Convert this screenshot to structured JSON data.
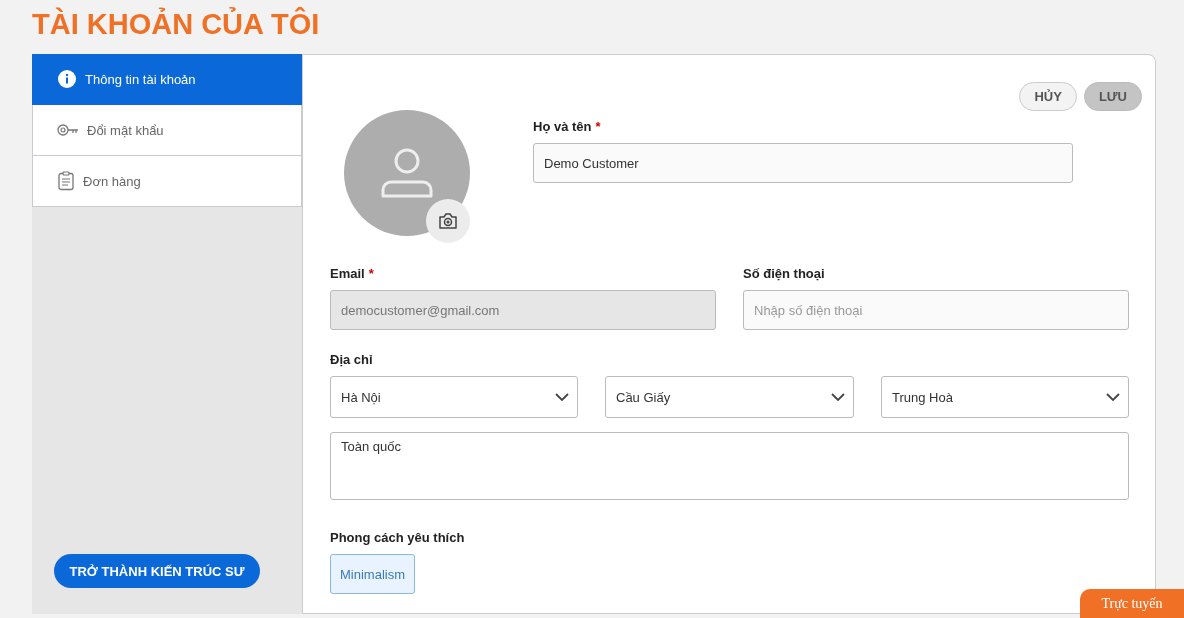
{
  "page_title": "TÀI KHOẢN CỦA TÔI",
  "sidebar": {
    "items": [
      {
        "label": "Thông tin tài khoản",
        "kind": "info",
        "selected": true
      },
      {
        "label": "Đổi mật khẩu",
        "kind": "key",
        "selected": false
      },
      {
        "label": "Đơn hàng",
        "kind": "orders",
        "selected": false
      }
    ],
    "cta": "TRỞ THÀNH KIẾN TRÚC SƯ"
  },
  "actions": [
    {
      "label": "HỦY",
      "kind": "cancel"
    },
    {
      "label": "LƯU",
      "kind": "save"
    }
  ],
  "full_name": {
    "label": "Họ và tên",
    "required_mark": "*",
    "value": "Demo Customer"
  },
  "email": {
    "label": "Email",
    "required_mark": "*",
    "value": "democustomer@gmail.com",
    "disabled": true
  },
  "phone": {
    "label": "Số điện thoại",
    "placeholder": "Nhập số điện thoại"
  },
  "address": {
    "label": "Địa chỉ",
    "selects": [
      "Hà Nội",
      "Cầu Giấy",
      "Trung Hoà"
    ],
    "detail": "Toàn quốc"
  },
  "favorite_styles": {
    "label": "Phong cách yêu thích",
    "items": [
      {
        "label": "Minimalism",
        "selected": true
      }
    ]
  },
  "chat_tab": "Trực tuyến"
}
